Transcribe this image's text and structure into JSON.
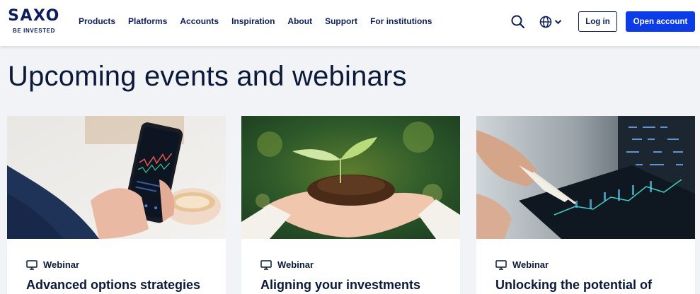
{
  "logo": {
    "word": "SAXO",
    "tagline": "BE INVESTED"
  },
  "nav": {
    "items": [
      {
        "label": "Products"
      },
      {
        "label": "Platforms"
      },
      {
        "label": "Accounts"
      },
      {
        "label": "Inspiration"
      },
      {
        "label": "About"
      },
      {
        "label": "Support"
      },
      {
        "label": "For institutions"
      }
    ]
  },
  "header_actions": {
    "search_icon": "search-icon",
    "language_icon": "globe-icon",
    "login_label": "Log in",
    "open_account_label": "Open account"
  },
  "main": {
    "title": "Upcoming events and webinars",
    "cards": [
      {
        "image": "phone-trading-chart-photo",
        "type": "Webinar",
        "title": "Advanced options strategies"
      },
      {
        "image": "seedling-in-hands-photo",
        "type": "Webinar",
        "title": "Aligning your investments"
      },
      {
        "image": "tablet-stock-data-photo",
        "type": "Webinar",
        "title": "Unlocking the potential of"
      }
    ]
  },
  "colors": {
    "brand_navy": "#0c1d5c",
    "accent_blue": "#0c3ce6",
    "page_bg": "#f1f3f6"
  }
}
